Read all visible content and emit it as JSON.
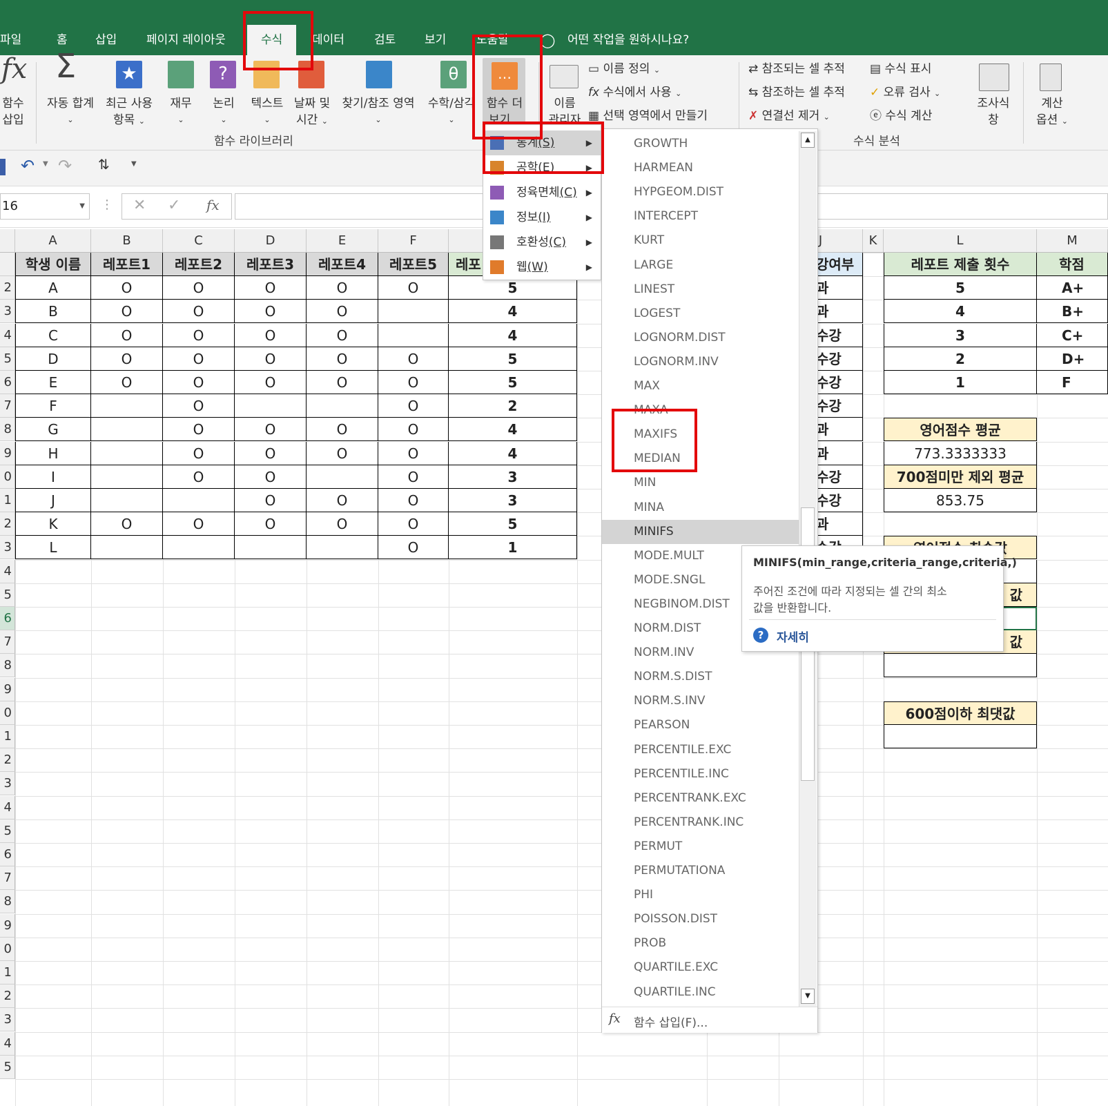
{
  "tabs": [
    "파일",
    "홈",
    "삽입",
    "페이지 레이아웃",
    "수식",
    "데이터",
    "검토",
    "보기",
    "도움말"
  ],
  "active_tab": "수식",
  "tell_me": "어떤 작업을 원하시나요?",
  "ribbon": {
    "insert_function": [
      "함수",
      "삽입"
    ],
    "autosum": "자동 합계",
    "recent": [
      "최근 사용",
      "항목"
    ],
    "finance": "재무",
    "logic": "논리",
    "text": "텍스트",
    "datetime": [
      "날짜 및",
      "시간"
    ],
    "lookup": "찾기/참조 영역",
    "math": "수학/삼각",
    "more": [
      "함수 더",
      "보기"
    ],
    "name_manager": [
      "이름",
      "관리자"
    ],
    "define_name": "이름 정의",
    "use_in_formula": "수식에서 사용",
    "create_from_selection": "선택 영역에서 만들기",
    "trace_precedents": "참조되는 셀 추적",
    "trace_dependents": "참조하는 셀 추적",
    "remove_arrows": "연결선 제거",
    "show_formulas": "수식 표시",
    "error_check": "오류 검사",
    "evaluate": "수식 계산",
    "watch_window": [
      "조사식",
      "창"
    ],
    "calc_options": [
      "계산",
      "옵션"
    ],
    "group_library": "함수 라이브러리",
    "group_audit": "수식 분석"
  },
  "name_box": "16",
  "fx_label": "fx",
  "columns": [
    "A",
    "B",
    "C",
    "D",
    "E",
    "F",
    "J",
    "K",
    "L",
    "M"
  ],
  "rows": [
    "2",
    "3",
    "4",
    "5",
    "6",
    "7",
    "8",
    "9",
    "0",
    "1",
    "2",
    "3",
    "4",
    "5",
    "6",
    "7",
    "8",
    "9",
    "0",
    "1",
    "2",
    "3",
    "4",
    "5",
    "6",
    "7",
    "8",
    "9",
    "0",
    "1",
    "2",
    "3",
    "4",
    "5"
  ],
  "table_header": [
    "학생 이름",
    "레포트1",
    "레포트2",
    "레포트3",
    "레포트4",
    "레포트5",
    "레포"
  ],
  "table_rows": [
    [
      "A",
      "O",
      "O",
      "O",
      "O",
      "O",
      "5"
    ],
    [
      "B",
      "O",
      "O",
      "O",
      "O",
      "",
      "4"
    ],
    [
      "C",
      "O",
      "O",
      "O",
      "O",
      "",
      "4"
    ],
    [
      "D",
      "O",
      "O",
      "O",
      "O",
      "O",
      "5"
    ],
    [
      "E",
      "O",
      "O",
      "O",
      "O",
      "O",
      "5"
    ],
    [
      "F",
      "",
      "O",
      "",
      "",
      "O",
      "2"
    ],
    [
      "G",
      "",
      "O",
      "O",
      "O",
      "O",
      "4"
    ],
    [
      "H",
      "",
      "O",
      "O",
      "O",
      "O",
      "4"
    ],
    [
      "I",
      "",
      "O",
      "O",
      "",
      "O",
      "3"
    ],
    [
      "J",
      "",
      "",
      "O",
      "O",
      "O",
      "3"
    ],
    [
      "K",
      "O",
      "O",
      "O",
      "O",
      "O",
      "5"
    ],
    [
      "L",
      "",
      "",
      "",
      "",
      "O",
      "1"
    ]
  ],
  "j_header": "강여부",
  "j_values": [
    "과",
    "과",
    "수강",
    "수강",
    "수강",
    "수강",
    "과",
    "과",
    "수강",
    "수강",
    "과",
    "수강"
  ],
  "l_header": "레포트 제출 횟수",
  "l_values": [
    "5",
    "4",
    "3",
    "2",
    "1"
  ],
  "m_header": "학점",
  "m_values": [
    "A+",
    "B+",
    "C+",
    "D+",
    "F"
  ],
  "side_labels": {
    "avg_title": "영어점수 평균",
    "avg_value": "773.3333333",
    "excl_title": "700점미만 제외 평균",
    "excl_value": "853.75",
    "min_title": "영어점수 최솟값",
    "partial1": "값",
    "partial2": "값",
    "max600_title": "600점이하 최댓값"
  },
  "submenu": [
    {
      "label": "통계",
      "key": "(S)"
    },
    {
      "label": "공학",
      "key": "(E)"
    },
    {
      "label": "정육면체",
      "key": "(C)"
    },
    {
      "label": "정보",
      "key": "(I)"
    },
    {
      "label": "호환성",
      "key": "(C)"
    },
    {
      "label": "웹",
      "key": "(W)"
    }
  ],
  "functions": [
    "GROWTH",
    "HARMEAN",
    "HYPGEOM.DIST",
    "INTERCEPT",
    "KURT",
    "LARGE",
    "LINEST",
    "LOGEST",
    "LOGNORM.DIST",
    "LOGNORM.INV",
    "MAX",
    "MAXA",
    "MAXIFS",
    "MEDIAN",
    "MIN",
    "MINA",
    "MINIFS",
    "MODE.MULT",
    "MODE.SNGL",
    "NEGBINOM.DIST",
    "NORM.DIST",
    "NORM.INV",
    "NORM.S.DIST",
    "NORM.S.INV",
    "PEARSON",
    "PERCENTILE.EXC",
    "PERCENTILE.INC",
    "PERCENTRANK.EXC",
    "PERCENTRANK.INC",
    "PERMUT",
    "PERMUTATIONA",
    "PHI",
    "POISSON.DIST",
    "PROB",
    "QUARTILE.EXC",
    "QUARTILE.INC"
  ],
  "selected_function": "MINIFS",
  "insert_function_item": "함수 삽입(F)...",
  "tooltip": {
    "signature": "MINIFS(min_range,criteria_range,criteria,)",
    "desc1": "주어진 조건에 따라 지정되는 셀 간의 최소",
    "desc2": "값을 반환합니다.",
    "more": "자세히"
  },
  "colors": {
    "excel_green": "#217346",
    "header_gray": "#d9d9d9",
    "yellow": "#fff2cc",
    "green_hdr": "#d9ead3",
    "blue_hdr": "#ddebf7",
    "highlight_red": "#e3070b"
  }
}
